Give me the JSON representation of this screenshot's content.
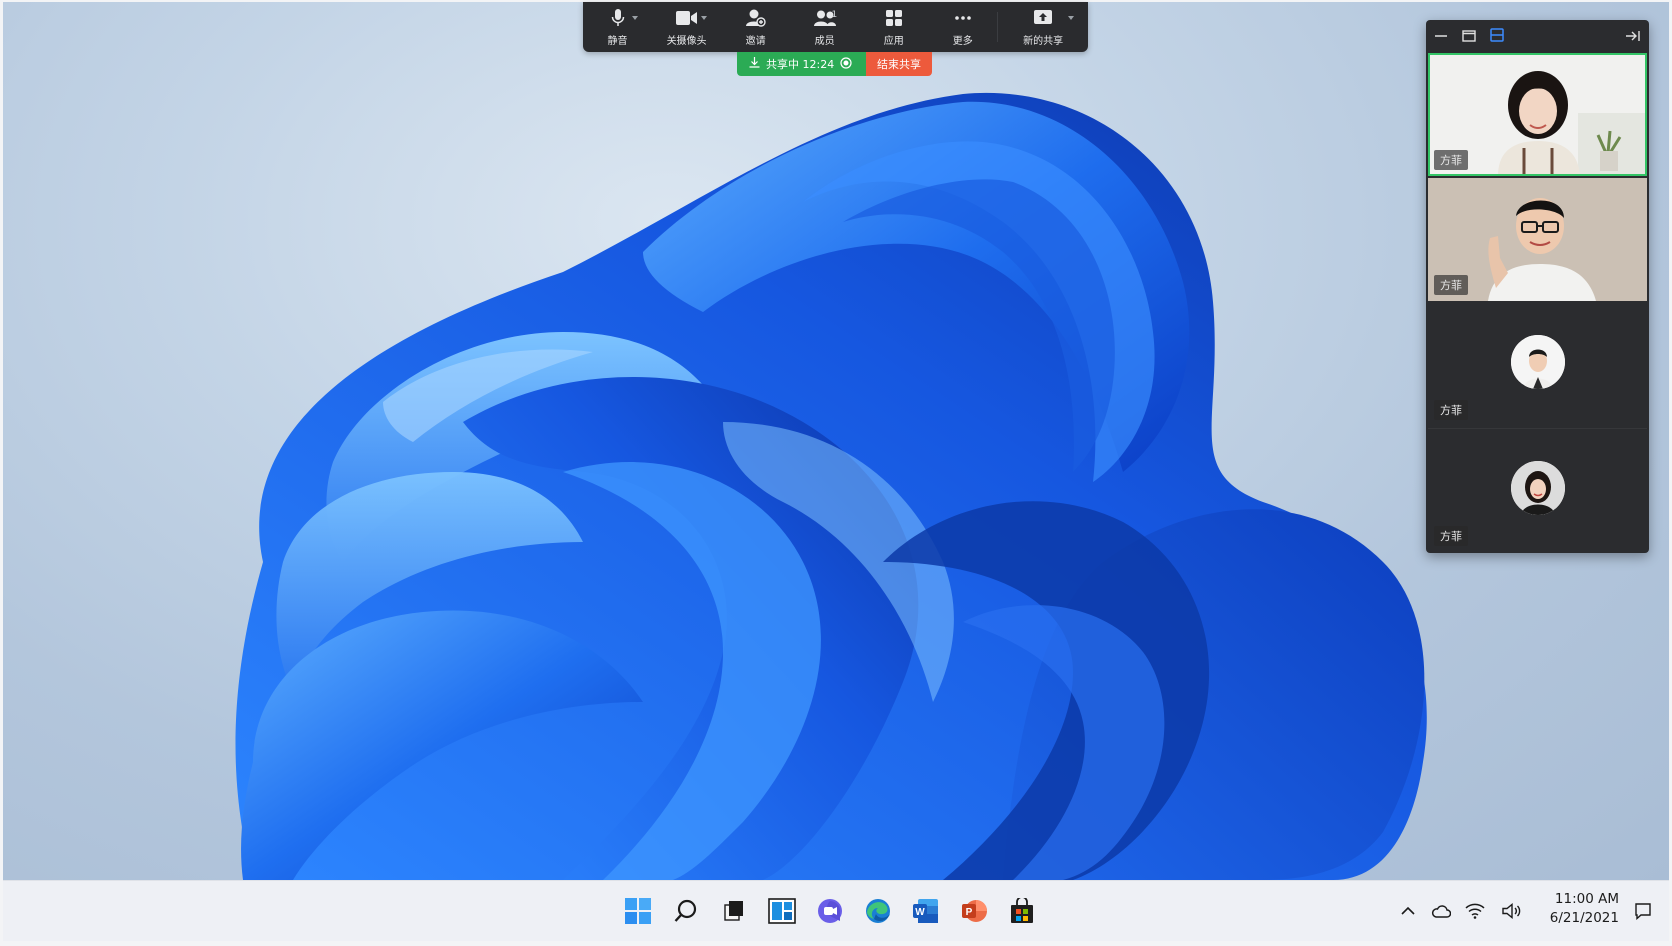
{
  "meeting_toolbar": {
    "buttons": [
      {
        "label": "静音",
        "icon": "microphone-icon"
      },
      {
        "label": "关摄像头",
        "icon": "camera-icon"
      },
      {
        "label": "邀请",
        "icon": "invite-user-icon"
      },
      {
        "label": "成员",
        "icon": "members-icon",
        "count": "1"
      },
      {
        "label": "应用",
        "icon": "apps-grid-icon"
      },
      {
        "label": "更多",
        "icon": "more-dots-icon"
      },
      {
        "label": "新的共享",
        "icon": "new-share-icon"
      }
    ]
  },
  "share_status": {
    "sharing_label": "共享中 12:24",
    "stop_label": "结束共享"
  },
  "video_panel": {
    "participants": [
      {
        "name": "方菲",
        "type": "video",
        "active": true
      },
      {
        "name": "方菲",
        "type": "video",
        "active": false
      },
      {
        "name": "方菲",
        "type": "avatar",
        "active": false
      },
      {
        "name": "方菲",
        "type": "avatar",
        "active": false
      }
    ]
  },
  "taskbar": {
    "apps": [
      "start-icon",
      "search-icon",
      "task-view-icon",
      "widgets-icon",
      "teams-chat-icon",
      "edge-icon",
      "word-icon",
      "powerpoint-icon",
      "store-icon"
    ],
    "tray": [
      "chevron-up-icon",
      "onedrive-cloud-icon",
      "wifi-icon",
      "volume-icon"
    ],
    "time": "11:00 AM",
    "date": "6/21/2021"
  },
  "colors": {
    "sharing_green": "#2bab55",
    "stop_red": "#ed5a3c",
    "active_speaker_outline": "#33c466",
    "toolbar_bg": "#2a2b2e"
  }
}
